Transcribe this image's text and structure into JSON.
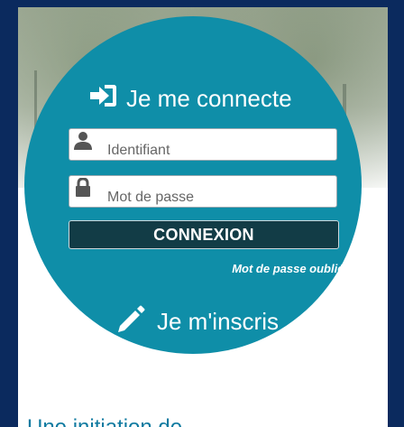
{
  "login": {
    "title": "Je me connecte",
    "username_placeholder": "Identifiant",
    "password_placeholder": "Mot de passe",
    "submit_label": "CONNEXION",
    "forgot_label": "Mot de passe oublié ?"
  },
  "register": {
    "title": "Je m'inscris"
  },
  "footer": {
    "partial_text": "Une initiation de"
  },
  "colors": {
    "circle": "#0f8ea8",
    "button": "#123c46",
    "frame": "#0b2a5e"
  },
  "icons": {
    "login": "sign-in-icon",
    "user": "user-icon",
    "lock": "lock-icon",
    "register": "pencil-icon"
  }
}
